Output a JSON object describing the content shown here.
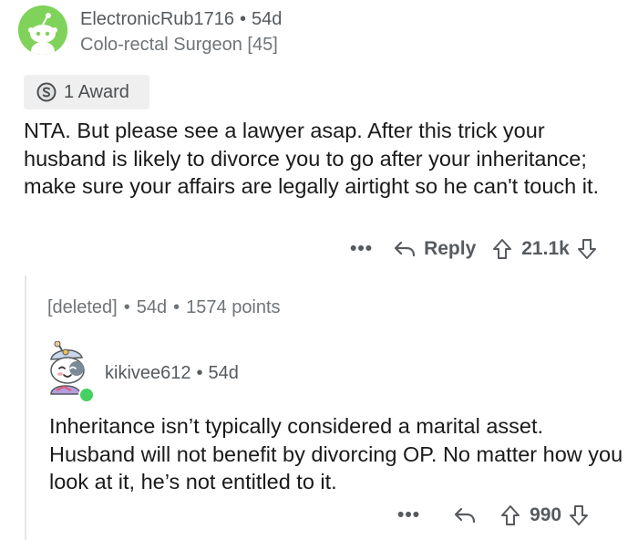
{
  "comment": {
    "username": "ElectronicRub1716",
    "separator": "•",
    "age": "54d",
    "flair": "Colo-rectal Surgeon [45]",
    "award_label": "1 Award",
    "body": "NTA.  But please see a lawyer asap.  After this trick your husband is likely to divorce you to go after your inheritance; make sure your affairs are legally airtight so he can't touch it.",
    "more_label": "•••",
    "reply_label": "Reply",
    "score": "21.1k"
  },
  "deleted_reply": {
    "username": "[deleted]",
    "separator": "•",
    "age": "54d",
    "points": "1574 points"
  },
  "reply": {
    "username": "kikivee612",
    "separator": "•",
    "age": "54d",
    "body": "Inheritance isn’t typically considered a marital asset. Husband will not benefit by divorcing OP. No matter how you look at it, he’s not entitled to it.",
    "more_label": "•••",
    "score": "990"
  },
  "colors": {
    "avatar_green": "#7fd35a",
    "online_green": "#46d160",
    "meta_gray": "#6f7478",
    "text": "#1a1a1b"
  },
  "icons": [
    "snoo-avatar-icon",
    "silver-award-icon",
    "reply-arrow-icon",
    "upvote-icon",
    "downvote-icon",
    "custom-avatar-icon"
  ]
}
